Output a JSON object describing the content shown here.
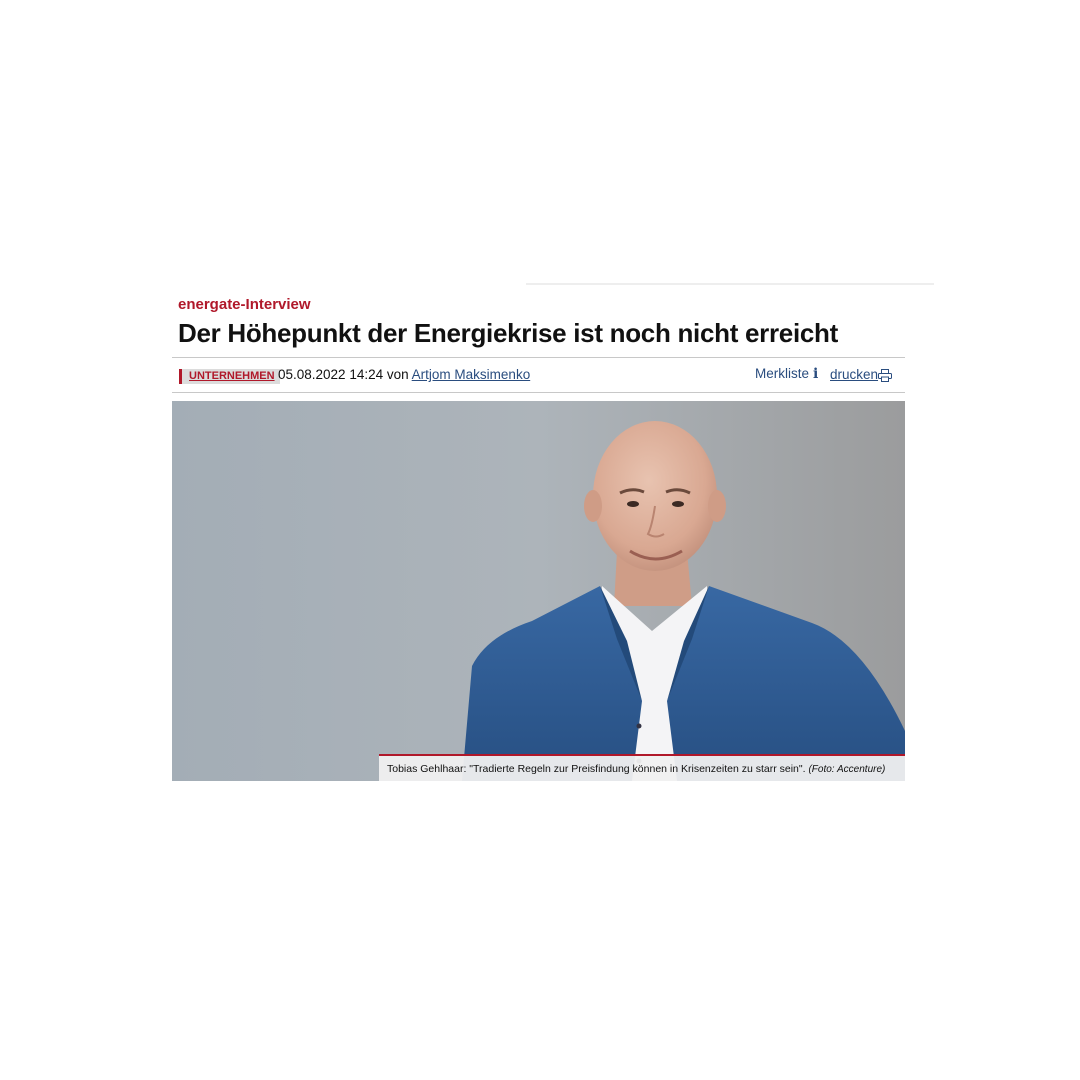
{
  "article": {
    "kicker": "energate-Interview",
    "headline": "Der Höhepunkt der Energiekrise ist noch nicht erreicht",
    "category": "UNTERNEHMEN",
    "datetime": "05.08.2022 14:24",
    "by": "von",
    "author": "Artjom Maksimenko",
    "bookmark_label": "Merkliste",
    "print_label": "drucken"
  },
  "photo": {
    "caption": "Tobias Gehlhaar: \"Tradierte Regeln zur Preisfindung können in Krisenzeiten zu starr sein\".",
    "credit": "(Foto: Accenture)"
  },
  "colors": {
    "accent": "#b0182a",
    "link": "#2a4d7f",
    "jacket": "#2e5c94"
  },
  "icons": {
    "bookmark": "info-icon",
    "print": "printer-icon"
  }
}
